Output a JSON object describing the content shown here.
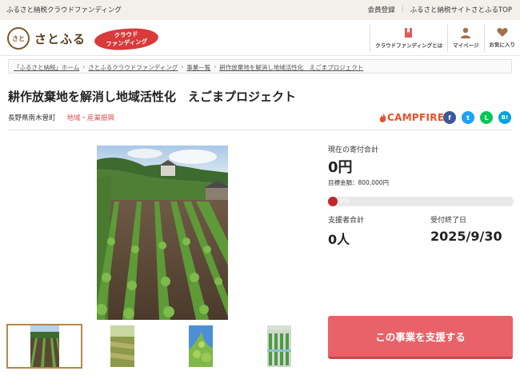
{
  "topbar": {
    "site_label": "ふるさと納税クラウドファンディング",
    "links": [
      "会員登録",
      "ふるさと納税サイトさとふるTOP"
    ]
  },
  "header": {
    "logo_mark": "さと",
    "logo_text": "さとふる",
    "badge_line1": "クラウド",
    "badge_line2": "ファンディング",
    "nav": [
      {
        "label": "クラウドファンディングとは",
        "icon": "book-icon"
      },
      {
        "label": "マイページ",
        "icon": "user-icon"
      },
      {
        "label": "お気に入り",
        "icon": "heart-icon"
      }
    ]
  },
  "breadcrumb": [
    "「ふるさと納税」ホーム",
    "さとふるクラウドファンディング",
    "事業一覧",
    "耕作放棄地を解消し地域活性化　えごまプロジェクト"
  ],
  "project": {
    "title": "耕作放棄地を解消し地域活性化　えごまプロジェクト",
    "location": "長野県南木曽町",
    "category": "地域・産業振興",
    "brand": "CAMPFIRE"
  },
  "shares": [
    {
      "name": "facebook",
      "glyph": "f",
      "color": "#3b5998"
    },
    {
      "name": "twitter",
      "glyph": "t",
      "color": "#1da1f2"
    },
    {
      "name": "line",
      "glyph": "L",
      "color": "#06c755"
    },
    {
      "name": "hatena",
      "glyph": "B!",
      "color": "#00a4de"
    }
  ],
  "stats": {
    "current_label": "現在の寄付合計",
    "current_value": "0円",
    "target_text": "目標金額：800,000円",
    "progress_percent": 0,
    "progress_label": "0%",
    "supporters_label": "支援者合計",
    "supporters_value": "0人",
    "deadline_label": "受付終了日",
    "deadline_value": "2025/9/30"
  },
  "support_button": "この事業を支援する",
  "colors": {
    "accent": "#e86268",
    "progress": "#c0282e",
    "brand": "#e8502b"
  }
}
